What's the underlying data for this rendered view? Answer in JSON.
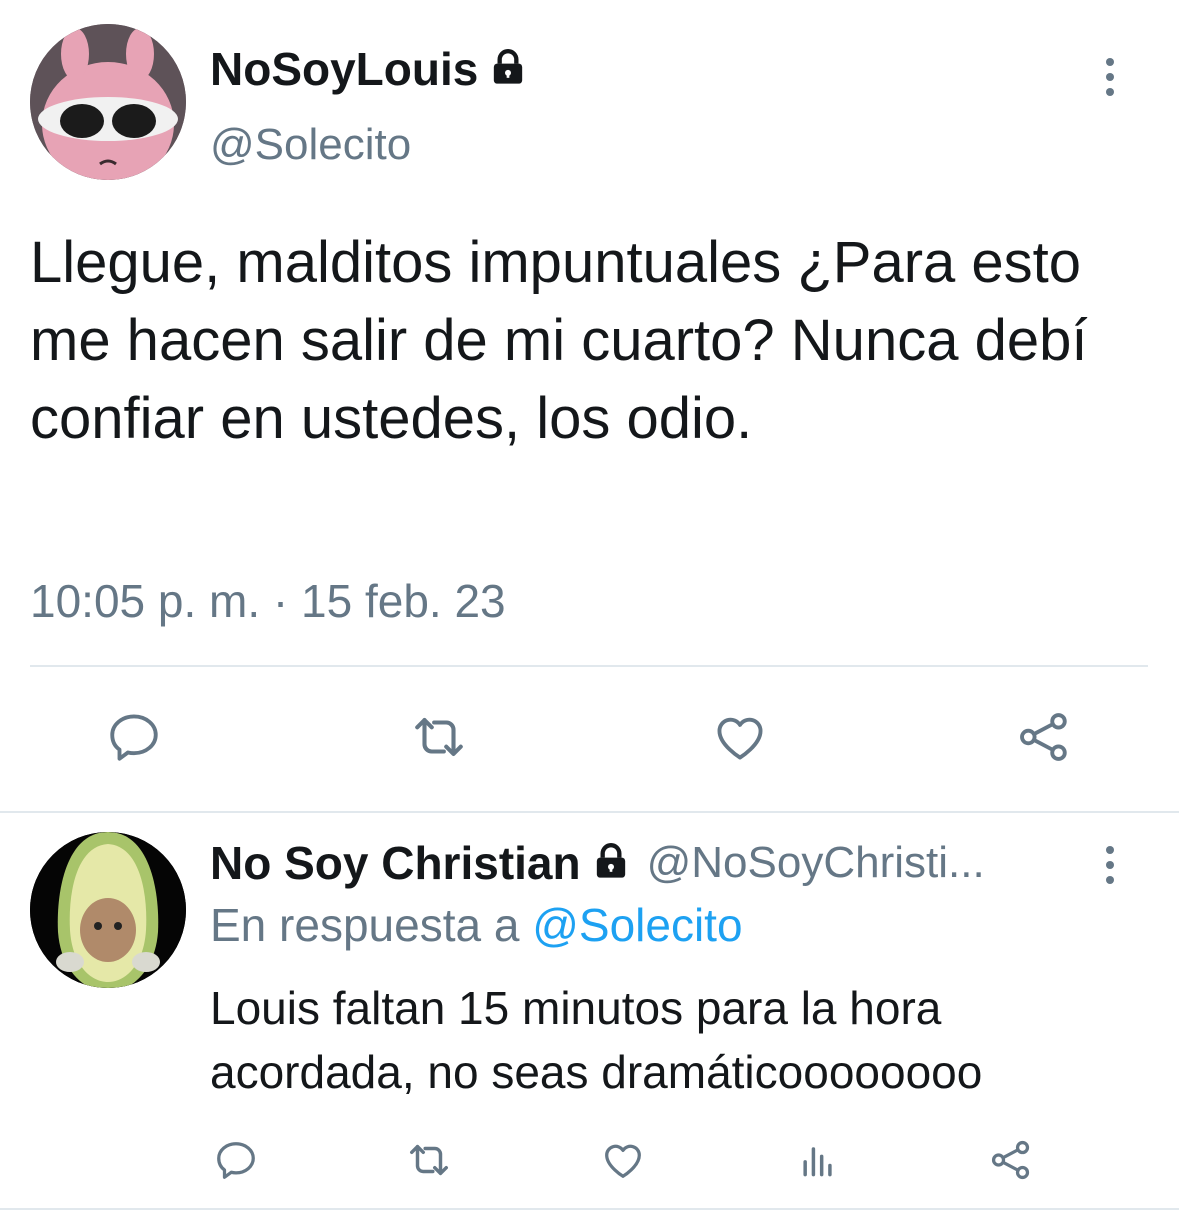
{
  "main_tweet": {
    "display_name": "NoSoyLouis",
    "handle": "@Solecito",
    "text": "Llegue, malditos impuntuales ¿Para esto me hacen salir de mi cuarto? Nunca debí confiar en ustedes, los odio.",
    "timestamp": "10:05 p. m. · 15 feb. 23",
    "protected_icon": "lock-icon",
    "menu_icon": "more-vertical-icon",
    "actions": [
      "reply-icon",
      "retweet-icon",
      "like-icon",
      "share-icon"
    ]
  },
  "reply_tweet": {
    "display_name": "No Soy Christian",
    "handle": "@NoSoyChristi...",
    "reply_prefix": "En respuesta a",
    "reply_to": "@Solecito",
    "text": "Louis faltan 15 minutos para la hora acordada, no seas dramáticoooooooo",
    "protected_icon": "lock-icon",
    "menu_icon": "more-vertical-icon",
    "actions": [
      "reply-icon",
      "retweet-icon",
      "like-icon",
      "analytics-icon",
      "share-icon"
    ]
  },
  "colors": {
    "text": "#14171a",
    "muted": "#657786",
    "link": "#1da1f2",
    "divider": "#e1e8ed"
  }
}
